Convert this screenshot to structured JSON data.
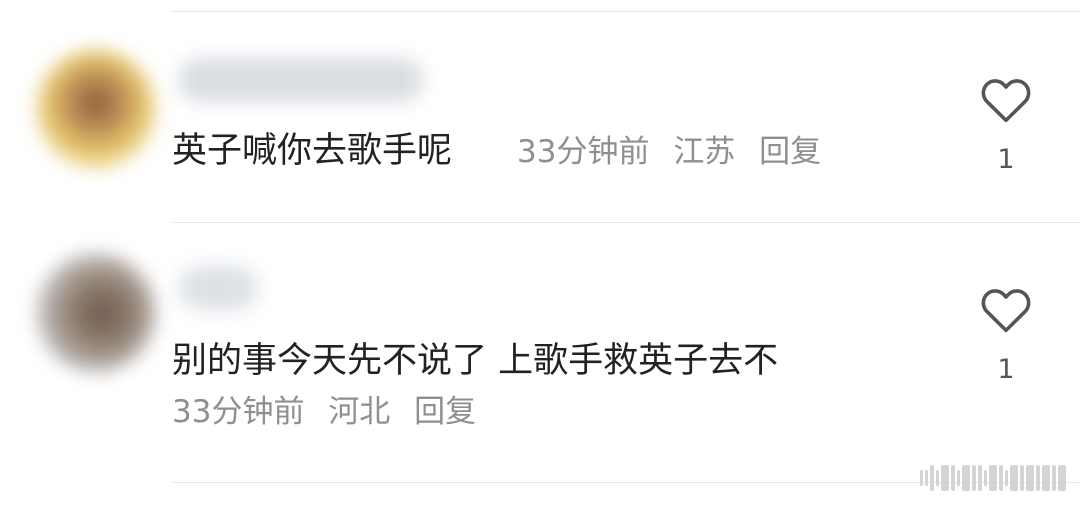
{
  "comments": [
    {
      "content": "英子喊你去歌手呢",
      "time": "33分钟前",
      "location": "江苏",
      "reply_label": "回复",
      "like_count": "1",
      "avatar_icon": "avatar-blurred",
      "username_icon": "username-blurred"
    },
    {
      "content": "别的事今天先不说了 上歌手救英子去不",
      "time": "33分钟前",
      "location": "河北",
      "reply_label": "回复",
      "like_count": "1",
      "avatar_icon": "avatar-blurred",
      "username_icon": "username-blurred"
    }
  ],
  "colors": {
    "content_text": "#222222",
    "meta_text": "#8f8f8f",
    "like_count_text": "#555555",
    "divider": "#e6e6e6",
    "heart_outline": "#555555"
  }
}
